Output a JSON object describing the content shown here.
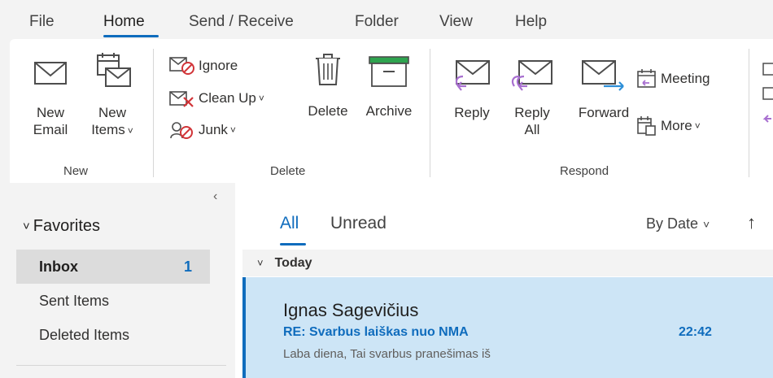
{
  "menu": {
    "tabs": [
      {
        "label": "File"
      },
      {
        "label": "Home"
      },
      {
        "label": "Send / Receive"
      },
      {
        "label": "Folder"
      },
      {
        "label": "View"
      },
      {
        "label": "Help"
      }
    ],
    "active": "Home"
  },
  "ribbon": {
    "new_group": {
      "label": "New",
      "new_email": [
        "New",
        "Email"
      ],
      "new_items": [
        "New",
        "Items"
      ]
    },
    "delete_group": {
      "label": "Delete",
      "ignore": "Ignore",
      "clean_up": "Clean Up",
      "junk": "Junk",
      "delete": "Delete",
      "archive": "Archive"
    },
    "respond_group": {
      "label": "Respond",
      "reply": "Reply",
      "reply_all": [
        "Reply",
        "All"
      ],
      "forward": "Forward",
      "meeting": "Meeting",
      "more": "More"
    }
  },
  "folders": {
    "favorites_label": "Favorites",
    "items": [
      {
        "label": "Inbox",
        "count": "1",
        "selected": true
      },
      {
        "label": "Sent Items",
        "count": ""
      },
      {
        "label": "Deleted Items",
        "count": ""
      }
    ]
  },
  "message_list": {
    "filter_tabs": [
      {
        "label": "All",
        "active": true
      },
      {
        "label": "Unread",
        "active": false
      }
    ],
    "sort_label": "By Date",
    "group_header": "Today",
    "messages": [
      {
        "sender": "Ignas Sagevičius",
        "subject": "RE: Svarbus laiškas nuo NMA",
        "time": "22:42",
        "preview": "Laba diena,  Tai svarbus pranešimas iš"
      }
    ]
  },
  "colors": {
    "accent": "#0f6cbd",
    "selected_message_bg": "#cde5f6",
    "reply_purple": "#a86fd0",
    "forward_blue": "#2e8fd8",
    "junk_red": "#d13438",
    "archive_green": "#2ea44f"
  }
}
